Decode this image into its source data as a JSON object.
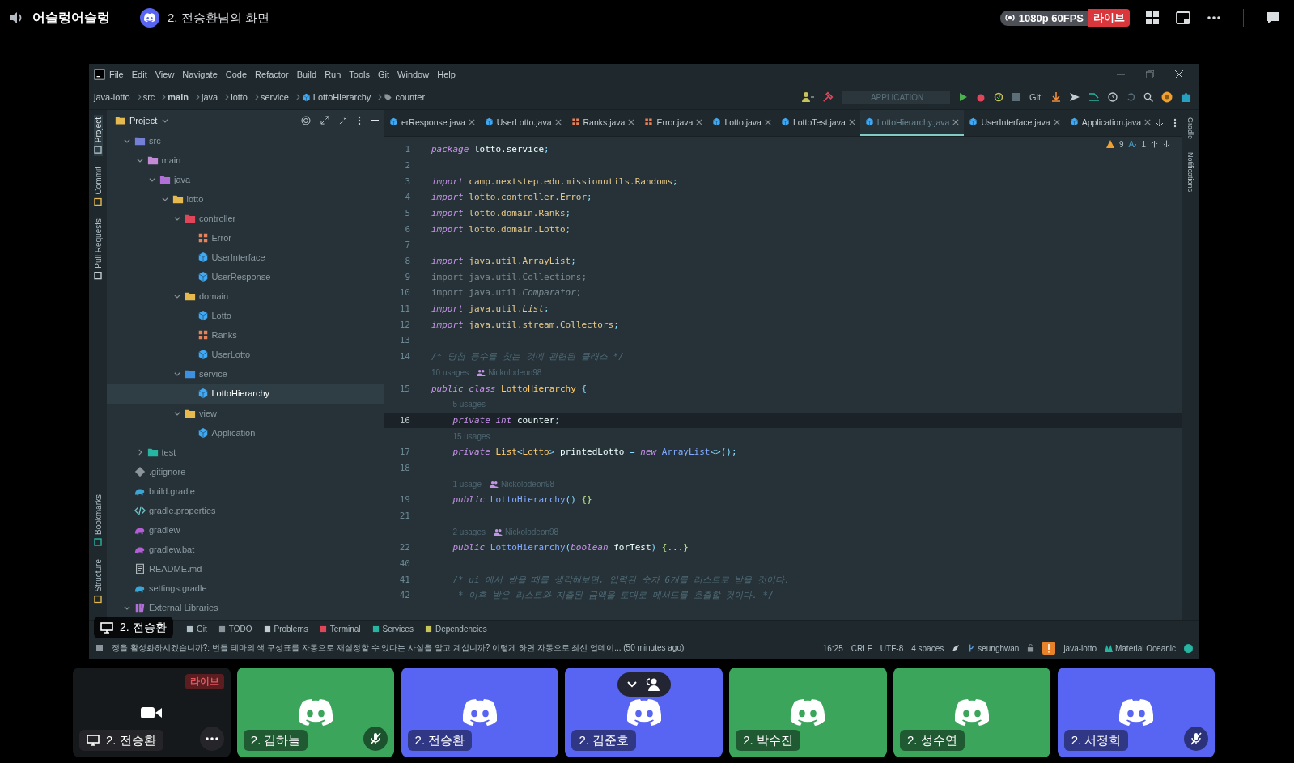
{
  "top_bar": {
    "server_name": "어슬렁어슬렁",
    "stream_title": "2. 전승환님의 화면",
    "quality": "1080p 60FPS",
    "live_badge": "라이브"
  },
  "ide": {
    "menu": [
      "File",
      "Edit",
      "View",
      "Navigate",
      "Code",
      "Refactor",
      "Build",
      "Run",
      "Tools",
      "Git",
      "Window",
      "Help"
    ],
    "breadcrumbs": [
      {
        "label": "java-lotto",
        "kind": "plain"
      },
      {
        "label": "src",
        "kind": "plain"
      },
      {
        "label": "main",
        "kind": "bold"
      },
      {
        "label": "java",
        "kind": "plain"
      },
      {
        "label": "lotto",
        "kind": "plain"
      },
      {
        "label": "service",
        "kind": "plain"
      },
      {
        "label": "LottoHierarchy",
        "kind": "class"
      },
      {
        "label": "counter",
        "kind": "field"
      }
    ],
    "run_config": "APPLICATION",
    "git_label": "Git:",
    "left_tools_top": [
      {
        "label": "Project",
        "selected": true
      },
      {
        "label": "Commit",
        "selected": false
      },
      {
        "label": "Pull Requests",
        "selected": false
      }
    ],
    "left_tools_bottom": [
      {
        "label": "Bookmarks",
        "selected": false
      },
      {
        "label": "Structure",
        "selected": false
      }
    ],
    "right_tools": [
      "Gradle",
      "Notifications"
    ],
    "project_panel": {
      "title": "Project",
      "tree": [
        {
          "label": "src",
          "kind": "source-root",
          "expanded": true,
          "selected": false,
          "children": [
            {
              "label": "main",
              "kind": "module",
              "expanded": true,
              "selected": false,
              "children": [
                {
                  "label": "java",
                  "kind": "java-root",
                  "expanded": true,
                  "selected": false,
                  "children": [
                    {
                      "label": "lotto",
                      "kind": "package",
                      "expanded": true,
                      "selected": false,
                      "children": [
                        {
                          "label": "controller",
                          "kind": "package-controller",
                          "expanded": true,
                          "selected": false,
                          "children": [
                            {
                              "label": "Error",
                              "kind": "enum",
                              "selected": false
                            },
                            {
                              "label": "UserInterface",
                              "kind": "class",
                              "selected": false
                            },
                            {
                              "label": "UserResponse",
                              "kind": "class",
                              "selected": false
                            }
                          ]
                        },
                        {
                          "label": "domain",
                          "kind": "package",
                          "expanded": true,
                          "selected": false,
                          "children": [
                            {
                              "label": "Lotto",
                              "kind": "class",
                              "selected": false
                            },
                            {
                              "label": "Ranks",
                              "kind": "enum",
                              "selected": false
                            },
                            {
                              "label": "UserLotto",
                              "kind": "class",
                              "selected": false
                            }
                          ]
                        },
                        {
                          "label": "service",
                          "kind": "package-service",
                          "expanded": true,
                          "selected": false,
                          "children": [
                            {
                              "label": "LottoHierarchy",
                              "kind": "class",
                              "selected": true
                            }
                          ]
                        },
                        {
                          "label": "view",
                          "kind": "package",
                          "expanded": true,
                          "selected": false,
                          "children": [
                            {
                              "label": "Application",
                              "kind": "class",
                              "selected": false
                            }
                          ]
                        }
                      ]
                    }
                  ]
                }
              ]
            },
            {
              "label": "test",
              "kind": "test-root",
              "expanded": false,
              "selected": false
            }
          ]
        },
        {
          "label": ".gitignore",
          "kind": "ignore",
          "selected": false
        },
        {
          "label": "build.gradle",
          "kind": "gradle",
          "selected": false
        },
        {
          "label": "gradle.properties",
          "kind": "properties",
          "selected": false
        },
        {
          "label": "gradlew",
          "kind": "script",
          "selected": false
        },
        {
          "label": "gradlew.bat",
          "kind": "script",
          "selected": false
        },
        {
          "label": "README.md",
          "kind": "readme",
          "selected": false
        },
        {
          "label": "settings.gradle",
          "kind": "gradle",
          "selected": false
        },
        {
          "label": "External Libraries",
          "kind": "library",
          "expanded": true,
          "selected": false
        }
      ]
    },
    "tabs": [
      {
        "label": "erResponse.java",
        "kind": "class",
        "selected": false
      },
      {
        "label": "UserLotto.java",
        "kind": "class",
        "selected": false
      },
      {
        "label": "Ranks.java",
        "kind": "enum",
        "selected": false
      },
      {
        "label": "Error.java",
        "kind": "enum",
        "selected": false
      },
      {
        "label": "Lotto.java",
        "kind": "class",
        "selected": false
      },
      {
        "label": "LottoTest.java",
        "kind": "class",
        "selected": false
      },
      {
        "label": "LottoHierarchy.java",
        "kind": "class",
        "selected": true
      },
      {
        "label": "UserInterface.java",
        "kind": "class",
        "selected": false
      },
      {
        "label": "Application.java",
        "kind": "class",
        "selected": false
      }
    ],
    "inspections": {
      "warnings": "9",
      "typos": "1"
    },
    "code_lines": [
      {
        "kind": "code",
        "number": "1",
        "current": false,
        "tokens": [
          {
            "text": "package",
            "kind": "keyword"
          },
          {
            "text": " lotto.service",
            "kind": "plain"
          },
          {
            "text": ";",
            "kind": "punct"
          }
        ]
      },
      {
        "kind": "code",
        "number": "2",
        "current": false
      },
      {
        "kind": "code",
        "number": "3",
        "current": false,
        "tokens": [
          {
            "text": "import",
            "kind": "import-kw"
          },
          {
            "text": " camp.nextstep.edu.missionutils.Randoms",
            "kind": "import"
          },
          {
            "text": ";",
            "kind": "punct"
          }
        ]
      },
      {
        "kind": "code",
        "number": "4",
        "current": false,
        "tokens": [
          {
            "text": "import",
            "kind": "import-kw"
          },
          {
            "text": " lotto.controller.Error",
            "kind": "import"
          },
          {
            "text": ";",
            "kind": "punct"
          }
        ]
      },
      {
        "kind": "code",
        "number": "5",
        "current": false,
        "tokens": [
          {
            "text": "import",
            "kind": "import-kw"
          },
          {
            "text": " lotto.domain.Ranks",
            "kind": "import"
          },
          {
            "text": ";",
            "kind": "punct"
          }
        ]
      },
      {
        "kind": "code",
        "number": "6",
        "current": false,
        "tokens": [
          {
            "text": "import",
            "kind": "import-kw"
          },
          {
            "text": " lotto.domain.Lotto",
            "kind": "import"
          },
          {
            "text": ";",
            "kind": "punct"
          }
        ]
      },
      {
        "kind": "code",
        "number": "7",
        "current": false
      },
      {
        "kind": "code",
        "number": "8",
        "current": false,
        "tokens": [
          {
            "text": "import",
            "kind": "import-kw"
          },
          {
            "text": " java.util.ArrayList",
            "kind": "import"
          },
          {
            "text": ";",
            "kind": "punct"
          }
        ]
      },
      {
        "kind": "code",
        "number": "9",
        "current": false,
        "tokens": [
          {
            "text": "import java.util.Collections;",
            "kind": "unused"
          }
        ]
      },
      {
        "kind": "code",
        "number": "10",
        "current": false,
        "tokens": [
          {
            "text": "import java.util.",
            "kind": "unused"
          },
          {
            "text": "Comparator",
            "kind": "unused-italic"
          },
          {
            "text": ";",
            "kind": "unused"
          }
        ]
      },
      {
        "kind": "code",
        "number": "11",
        "current": false,
        "tokens": [
          {
            "text": "import",
            "kind": "import-kw"
          },
          {
            "text": " java.util.",
            "kind": "import"
          },
          {
            "text": "List",
            "kind": "import-italic"
          },
          {
            "text": ";",
            "kind": "punct"
          }
        ]
      },
      {
        "kind": "code",
        "number": "12",
        "current": false,
        "tokens": [
          {
            "text": "import",
            "kind": "import-kw"
          },
          {
            "text": " java.util.stream.Collectors",
            "kind": "import"
          },
          {
            "text": ";",
            "kind": "punct"
          }
        ]
      },
      {
        "kind": "code",
        "number": "13",
        "current": false
      },
      {
        "kind": "code",
        "number": "14",
        "current": false,
        "tokens": [
          {
            "text": "/* 당첨 등수를 찾는 것에 관련된 클래스 */",
            "kind": "comment"
          }
        ]
      },
      {
        "kind": "inlay",
        "usages": "10 usages",
        "author": "Nickolodeon98"
      },
      {
        "kind": "code",
        "number": "15",
        "current": false,
        "tokens": [
          {
            "text": "public class",
            "kind": "keyword"
          },
          {
            "text": " LottoHierarchy ",
            "kind": "type"
          },
          {
            "text": "{",
            "kind": "punct"
          }
        ]
      },
      {
        "kind": "inlay",
        "usages": "5 usages"
      },
      {
        "kind": "code",
        "number": "16",
        "current": true,
        "tokens": [
          {
            "text": "    private int",
            "kind": "keyword"
          },
          {
            "text": " counter",
            "kind": "plain"
          },
          {
            "text": ";",
            "kind": "punct"
          }
        ]
      },
      {
        "kind": "inlay",
        "usages": "15 usages"
      },
      {
        "kind": "code",
        "number": "17",
        "current": false,
        "tokens": [
          {
            "text": "    private",
            "kind": "keyword"
          },
          {
            "text": " List",
            "kind": "type"
          },
          {
            "text": "<",
            "kind": "punct"
          },
          {
            "text": "Lotto",
            "kind": "type"
          },
          {
            "text": ">",
            "kind": "punct"
          },
          {
            "text": " printedLotto ",
            "kind": "plain"
          },
          {
            "text": "=",
            "kind": "punct"
          },
          {
            "text": " new",
            "kind": "keyword"
          },
          {
            "text": " ArrayList",
            "kind": "method"
          },
          {
            "text": "<>();",
            "kind": "punct"
          }
        ]
      },
      {
        "kind": "code",
        "number": "18",
        "current": false
      },
      {
        "kind": "inlay",
        "usages": "1 usage",
        "author": "Nickolodeon98"
      },
      {
        "kind": "code",
        "number": "19",
        "current": false,
        "tokens": [
          {
            "text": "    public",
            "kind": "keyword"
          },
          {
            "text": " LottoHierarchy",
            "kind": "method"
          },
          {
            "text": "() ",
            "kind": "punct"
          },
          {
            "text": "{}",
            "kind": "fold"
          }
        ]
      },
      {
        "kind": "code",
        "number": "21",
        "current": false
      },
      {
        "kind": "inlay",
        "usages": "2 usages",
        "author": "Nickolodeon98"
      },
      {
        "kind": "code",
        "number": "22",
        "current": false,
        "tokens": [
          {
            "text": "    public",
            "kind": "keyword"
          },
          {
            "text": " LottoHierarchy",
            "kind": "method"
          },
          {
            "text": "(",
            "kind": "punct"
          },
          {
            "text": "boolean",
            "kind": "keyword"
          },
          {
            "text": " forTest",
            "kind": "plain"
          },
          {
            "text": ") ",
            "kind": "punct"
          },
          {
            "text": "{...}",
            "kind": "fold"
          }
        ]
      },
      {
        "kind": "code",
        "number": "40",
        "current": false
      },
      {
        "kind": "code",
        "number": "41",
        "current": false,
        "tokens": [
          {
            "text": "    /* ui 에서 받을 때를 생각해보면, 입력된 숫자 6개를 리스트로 받을 것이다.",
            "kind": "comment"
          }
        ]
      },
      {
        "kind": "code",
        "number": "42",
        "current": false,
        "tokens": [
          {
            "text": "     * 이후 받은 리스트와 지출된 금액을 토대로 메서드를 호출할 것이다. */",
            "kind": "comment"
          }
        ]
      }
    ],
    "tool_windows": [
      "Git",
      "TODO",
      "Problems",
      "Terminal",
      "Services",
      "Dependencies"
    ],
    "status_bar": {
      "message": "정을 활성화하시겠습니까?: 번들 테마의 색 구성표를 자동으로 재설정할 수 있다는 사실을 알고 계십니까? 이렇게 하면 자동으로 최신 업데이... (50 minutes ago)",
      "position": "16:25",
      "line_separator": "CRLF",
      "encoding": "UTF-8",
      "indent": "4 spaces",
      "branch": "seunghwan",
      "project": "java-lotto",
      "theme": "Material Oceanic"
    }
  },
  "stream_overlay": {
    "label": "2. 전승환"
  },
  "participants": [
    {
      "kind": "stream",
      "name": "2. 전승환",
      "badge": "라이브"
    },
    {
      "kind": "user",
      "name": "2. 김하늘",
      "color": "#3ba55c",
      "muted": true,
      "controls": false
    },
    {
      "kind": "user",
      "name": "2. 전승환",
      "color": "#5865f2",
      "muted": false,
      "controls": false
    },
    {
      "kind": "user",
      "name": "2. 김준호",
      "color": "#5865f2",
      "muted": false,
      "controls": true
    },
    {
      "kind": "user",
      "name": "2. 박수진",
      "color": "#3ba55c",
      "muted": false,
      "controls": false
    },
    {
      "kind": "user",
      "name": "2. 성수연",
      "color": "#3ba55c",
      "muted": false,
      "controls": false
    },
    {
      "kind": "user",
      "name": "2. 서정희",
      "color": "#5865f2",
      "muted": true,
      "controls": false
    }
  ]
}
